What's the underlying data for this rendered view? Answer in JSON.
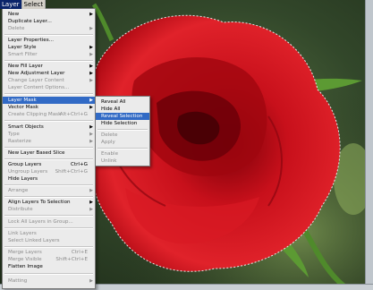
{
  "menubar": {
    "items": [
      "Layer",
      "Select"
    ]
  },
  "layer_menu": {
    "items": [
      {
        "label": "New",
        "shortcut": "",
        "submenu": true,
        "disabled": false
      },
      {
        "label": "Duplicate Layer...",
        "shortcut": "",
        "submenu": false,
        "disabled": false
      },
      {
        "label": "Delete",
        "shortcut": "",
        "submenu": true,
        "disabled": true
      },
      {
        "label": "Layer Properties...",
        "shortcut": "",
        "submenu": false,
        "disabled": false
      },
      {
        "label": "Layer Style",
        "shortcut": "",
        "submenu": true,
        "disabled": false
      },
      {
        "label": "Smart Filter",
        "shortcut": "",
        "submenu": true,
        "disabled": true
      },
      {
        "label": "New Fill Layer",
        "shortcut": "",
        "submenu": true,
        "disabled": false
      },
      {
        "label": "New Adjustment Layer",
        "shortcut": "",
        "submenu": true,
        "disabled": false
      },
      {
        "label": "Change Layer Content",
        "shortcut": "",
        "submenu": true,
        "disabled": true
      },
      {
        "label": "Layer Content Options...",
        "shortcut": "",
        "submenu": false,
        "disabled": true
      },
      {
        "label": "Layer Mask",
        "shortcut": "",
        "submenu": true,
        "disabled": false,
        "highlighted": true
      },
      {
        "label": "Vector Mask",
        "shortcut": "",
        "submenu": true,
        "disabled": false
      },
      {
        "label": "Create Clipping Mask",
        "shortcut": "Alt+Ctrl+G",
        "submenu": false,
        "disabled": true
      },
      {
        "label": "Smart Objects",
        "shortcut": "",
        "submenu": true,
        "disabled": false
      },
      {
        "label": "Type",
        "shortcut": "",
        "submenu": true,
        "disabled": true
      },
      {
        "label": "Rasterize",
        "shortcut": "",
        "submenu": true,
        "disabled": true
      },
      {
        "label": "New Layer Based Slice",
        "shortcut": "",
        "submenu": false,
        "disabled": false
      },
      {
        "label": "Group Layers",
        "shortcut": "Ctrl+G",
        "submenu": false,
        "disabled": false
      },
      {
        "label": "Ungroup Layers",
        "shortcut": "Shift+Ctrl+G",
        "submenu": false,
        "disabled": true
      },
      {
        "label": "Hide Layers",
        "shortcut": "",
        "submenu": false,
        "disabled": false
      },
      {
        "label": "Arrange",
        "shortcut": "",
        "submenu": true,
        "disabled": true
      },
      {
        "label": "Align Layers To Selection",
        "shortcut": "",
        "submenu": true,
        "disabled": false
      },
      {
        "label": "Distribute",
        "shortcut": "",
        "submenu": true,
        "disabled": true
      },
      {
        "label": "Lock All Layers in Group...",
        "shortcut": "",
        "submenu": false,
        "disabled": true
      },
      {
        "label": "Link Layers",
        "shortcut": "",
        "submenu": false,
        "disabled": true
      },
      {
        "label": "Select Linked Layers",
        "shortcut": "",
        "submenu": false,
        "disabled": true
      },
      {
        "label": "Merge Layers",
        "shortcut": "Ctrl+E",
        "submenu": false,
        "disabled": true
      },
      {
        "label": "Merge Visible",
        "shortcut": "Shift+Ctrl+E",
        "submenu": false,
        "disabled": true
      },
      {
        "label": "Flatten Image",
        "shortcut": "",
        "submenu": false,
        "disabled": false
      },
      {
        "label": "Matting",
        "shortcut": "",
        "submenu": true,
        "disabled": true
      }
    ]
  },
  "layer_mask_submenu": {
    "items": [
      {
        "label": "Reveal All",
        "disabled": false
      },
      {
        "label": "Hide All",
        "disabled": false
      },
      {
        "label": "Reveal Selection",
        "disabled": false,
        "highlighted": true
      },
      {
        "label": "Hide Selection",
        "disabled": false
      },
      {
        "label": "Delete",
        "disabled": true
      },
      {
        "label": "Apply",
        "disabled": true
      },
      {
        "label": "Enable",
        "disabled": true
      },
      {
        "label": "Unlink",
        "disabled": true
      }
    ]
  },
  "icons": {
    "submenu_arrow": "triangle-right-icon"
  },
  "colors": {
    "highlight": "#316ac5",
    "rose": "#c8111c",
    "menu_bg": "#ebebeb"
  }
}
